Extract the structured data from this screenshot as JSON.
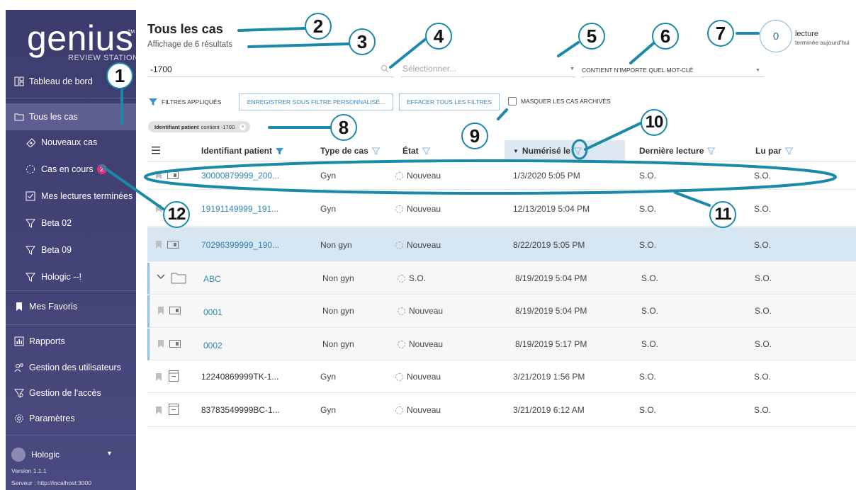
{
  "sidebar": {
    "logo_word": "genius",
    "logo_tm": "TM",
    "logo_sub": "REVIEW STATION",
    "items": [
      {
        "label": "Tableau de bord",
        "icon": "dashboard-icon"
      },
      {
        "label": "Tous les cas",
        "icon": "folder-icon"
      },
      {
        "label": "Nouveaux cas",
        "icon": "slide-icon"
      },
      {
        "label": "Cas en cours",
        "icon": "progress-icon",
        "badge": "2"
      },
      {
        "label": "Mes lectures terminées",
        "icon": "check-icon"
      },
      {
        "label": "Beta 02",
        "icon": "filter-icon"
      },
      {
        "label": "Beta 09",
        "icon": "filter-icon"
      },
      {
        "label": "Hologic --!",
        "icon": "filter-icon"
      },
      {
        "label": "Mes Favoris",
        "icon": "bookmark-icon"
      },
      {
        "label": "Rapports",
        "icon": "chart-icon"
      },
      {
        "label": "Gestion des utilisateurs",
        "icon": "users-icon"
      },
      {
        "label": "Gestion de l'accès",
        "icon": "access-icon"
      },
      {
        "label": "Paramètres",
        "icon": "gear-icon"
      }
    ],
    "user": "Hologic",
    "version": "Version 1.1.1",
    "server": "Serveur : http://localhost:3000"
  },
  "header": {
    "title": "Tous les cas",
    "results": "Affichage de 6 résultats",
    "search_value": "-1700",
    "state_placeholder": "Sélectionner...",
    "keyword_mode": "CONTIENT N'IMPORTE QUEL MOT-CLÉ",
    "read_count": "0",
    "read_label_1": "lecture",
    "read_label_2": "terminée aujourd'hui"
  },
  "filters": {
    "applied_label": "FILTRES APPLIQUÉS",
    "save_label": "ENREGISTRER SOUS FILTRE PERSONNALISÉ...",
    "clear_label": "EFFACER TOUS LES FILTRES",
    "hide_archived_label": "MASQUER LES CAS ARCHIVÉS",
    "chip_field": "Identifiant patient",
    "chip_value": "contient -1700"
  },
  "table": {
    "columns": [
      "Identifiant patient",
      "Type de cas",
      "État",
      "Numérisé le",
      "Dernière lecture",
      "Lu par"
    ],
    "rows": [
      {
        "id": "30000879999_200...",
        "type": "Gyn",
        "state": "Nouveau",
        "scanned": "1/3/2020 5:05 PM",
        "last_read": "S.O.",
        "read_by": "S.O."
      },
      {
        "id": "19191149999_191...",
        "type": "Gyn",
        "state": "Nouveau",
        "scanned": "12/13/2019 5:04 PM",
        "last_read": "S.O.",
        "read_by": "S.O."
      },
      {
        "id": "70296399999_190...",
        "type": "Non gyn",
        "state": "Nouveau",
        "scanned": "8/22/2019 5:05 PM",
        "last_read": "S.O.",
        "read_by": "S.O."
      },
      {
        "id": "ABC",
        "type": "Non gyn",
        "state": "S.O.",
        "scanned": "8/19/2019 5:04 PM",
        "last_read": "S.O.",
        "read_by": "S.O."
      },
      {
        "id": "0001",
        "type": "Non gyn",
        "state": "Nouveau",
        "scanned": "8/19/2019 5:04 PM",
        "last_read": "S.O.",
        "read_by": "S.O."
      },
      {
        "id": "0002",
        "type": "Non gyn",
        "state": "Nouveau",
        "scanned": "8/19/2019 5:17 PM",
        "last_read": "S.O.",
        "read_by": "S.O."
      },
      {
        "id": "12240869999TK-1...",
        "type": "Gyn",
        "state": "Nouveau",
        "scanned": "3/21/2019 1:56 PM",
        "last_read": "S.O.",
        "read_by": "S.O."
      },
      {
        "id": "83783549999BC-1...",
        "type": "Gyn",
        "state": "Nouveau",
        "scanned": "3/21/2019 6:12 AM",
        "last_read": "S.O.",
        "read_by": "S.O."
      }
    ]
  },
  "callouts": [
    "1",
    "2",
    "3",
    "4",
    "5",
    "6",
    "7",
    "8",
    "9",
    "10",
    "11",
    "12"
  ],
  "colors": {
    "sidebar": "#3c3c6e",
    "accent": "#1a8aa8",
    "link": "#2f86b8",
    "badge": "#e5317d"
  }
}
